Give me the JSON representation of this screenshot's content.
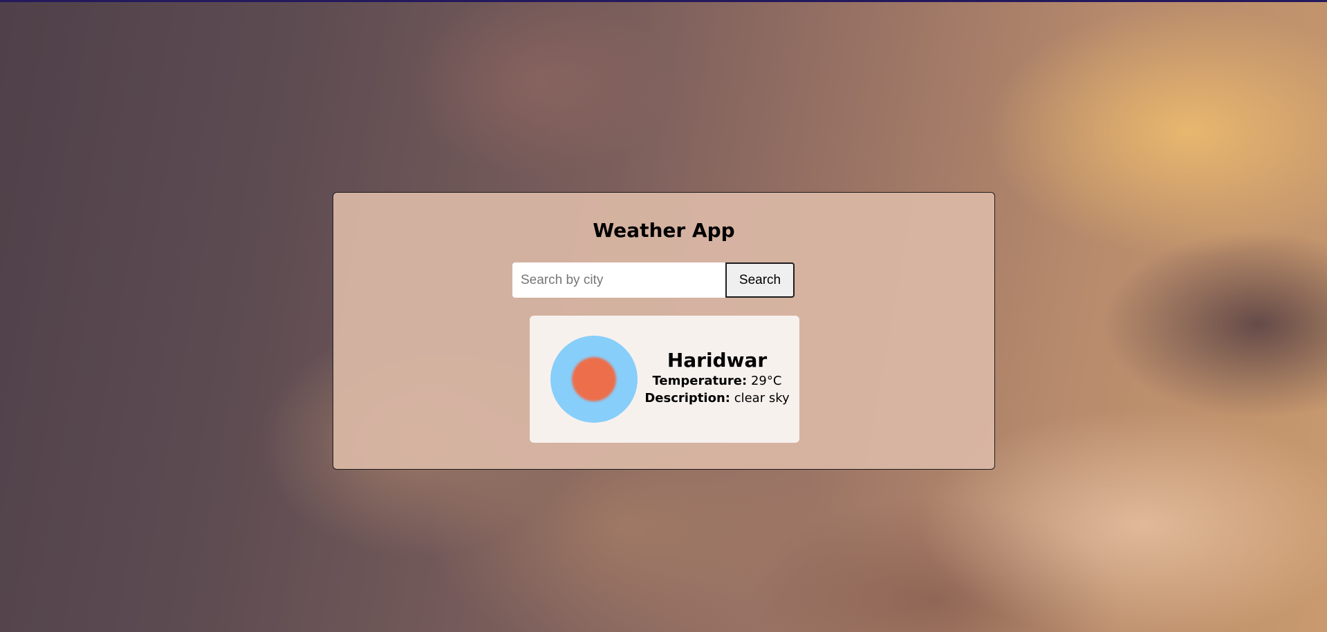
{
  "app": {
    "title": "Weather App"
  },
  "search": {
    "placeholder": "Search by city",
    "button_label": "Search"
  },
  "weather": {
    "city": "Haridwar",
    "temperature_label": "Temperature:",
    "temperature_value": "29°C",
    "description_label": "Description:",
    "description_value": "clear sky",
    "icon": "clear-sky-sun-icon",
    "icon_colors": {
      "sky": "#87cefa",
      "sun": "#ec6e4c"
    }
  }
}
